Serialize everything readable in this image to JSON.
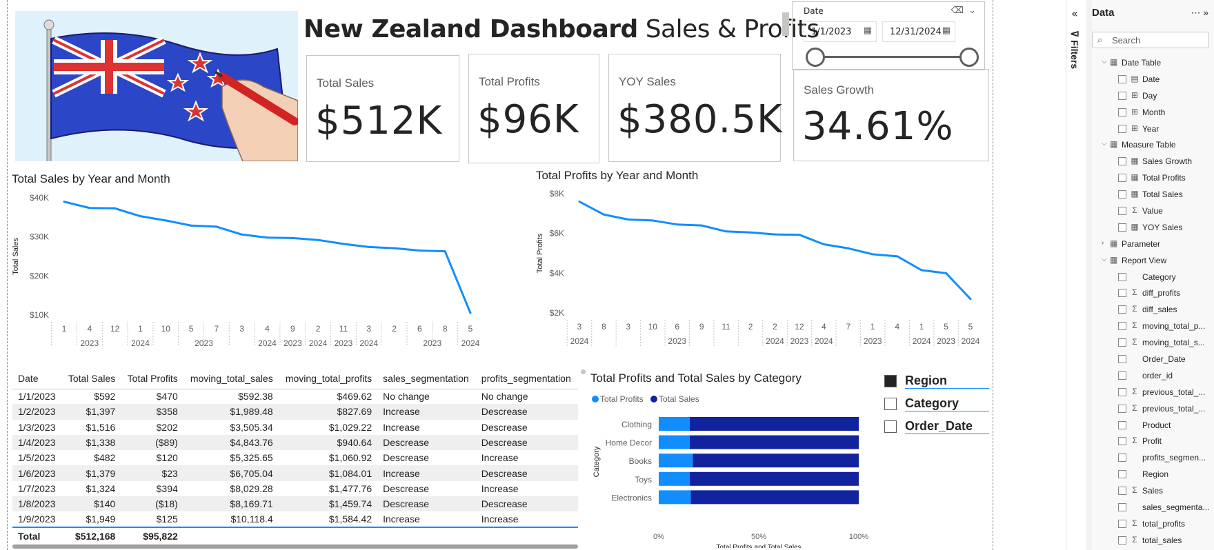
{
  "title": {
    "bold": "New Zealand Dashboard",
    "light": " Sales & Profits"
  },
  "kpis": [
    {
      "label": "Total Sales",
      "value": "$512K"
    },
    {
      "label": "Total Profits",
      "value": "$96K"
    },
    {
      "label": "YOY Sales",
      "value": "$380.5K"
    },
    {
      "label": "Sales Growth",
      "value": "34.61%"
    }
  ],
  "date_slicer": {
    "label": "Date",
    "start": "1/1/2023",
    "end": "12/31/2024",
    "range_selected": [
      0,
      1
    ]
  },
  "sales_chart": {
    "title": "Total Sales by Year and Month",
    "ylabel": "Total Sales",
    "yticks": [
      "$40K",
      "$30K",
      "$20K",
      "$10K"
    ],
    "month_ticks": [
      "1",
      "4",
      "12",
      "1",
      "10",
      "5",
      "7",
      "3",
      "4",
      "9",
      "2",
      "11",
      "3",
      "2",
      "6",
      "8",
      "5"
    ],
    "year_ticks": [
      {
        "label": "2023",
        "col": 1
      },
      {
        "label": "2024",
        "col": 3
      },
      {
        "label": "2023",
        "col": 5.5
      },
      {
        "label": "2024",
        "col": 8
      },
      {
        "label": "2023",
        "col": 9
      },
      {
        "label": "2024",
        "col": 10
      },
      {
        "label": "2023",
        "col": 11
      },
      {
        "label": "2024",
        "col": 12
      },
      {
        "label": "2023",
        "col": 14.5
      },
      {
        "label": "2024",
        "col": 16
      }
    ]
  },
  "profits_chart": {
    "title": "Total Profits by Year and Month",
    "ylabel": "Total Profits",
    "yticks": [
      "$8K",
      "$6K",
      "$4K",
      "$2K"
    ],
    "month_ticks": [
      "3",
      "8",
      "3",
      "10",
      "6",
      "9",
      "11",
      "2",
      "2",
      "12",
      "4",
      "7",
      "1",
      "4",
      "1",
      "5",
      "5"
    ],
    "year_ticks": [
      {
        "label": "2024",
        "col": 0
      },
      {
        "label": "2023",
        "col": 4
      },
      {
        "label": "2024",
        "col": 8
      },
      {
        "label": "2023",
        "col": 9
      },
      {
        "label": "2024",
        "col": 10
      },
      {
        "label": "2023",
        "col": 12
      },
      {
        "label": "2024",
        "col": 14
      },
      {
        "label": "2023",
        "col": 15
      },
      {
        "label": "2024",
        "col": 16
      }
    ]
  },
  "chart_data": [
    {
      "type": "line",
      "title": "Total Sales by Year and Month",
      "ylabel": "Total Sales",
      "ylim": [
        10000,
        40000
      ],
      "x": [
        "2023-1",
        "2023-4",
        "2023-12",
        "2024-1",
        "2024-10",
        "2023-5",
        "2023-7",
        "2023-3",
        "2024-4",
        "2023-9",
        "2024-2",
        "2023-11",
        "2024-3",
        "2023-2",
        "2023-6",
        "2023-8",
        "2024-5"
      ],
      "values": [
        39000,
        37400,
        37300,
        35300,
        34200,
        32900,
        32600,
        30600,
        29800,
        29700,
        29200,
        28200,
        27400,
        27100,
        26500,
        26300,
        10500
      ],
      "color": "#118dff"
    },
    {
      "type": "line",
      "title": "Total Profits by Year and Month",
      "ylabel": "Total Profits",
      "ylim": [
        2000,
        8000
      ],
      "x": [
        "2024-3",
        "2023-8",
        "2023-3",
        "2023-10",
        "2023-6",
        "2023-9",
        "2023-11",
        "2023-2",
        "2024-2",
        "2023-12",
        "2024-4",
        "2023-7",
        "2023-1",
        "2023-4",
        "2024-1",
        "2023-5",
        "2024-5"
      ],
      "values": [
        7600,
        6950,
        6700,
        6650,
        6450,
        6400,
        6100,
        6050,
        5950,
        5930,
        5450,
        5250,
        4950,
        4850,
        4150,
        4000,
        2700
      ],
      "color": "#118dff"
    },
    {
      "type": "bar",
      "orientation": "horizontal-stacked-100",
      "title": "Total Profits and Total Sales by Category",
      "xlabel": "Total Profits and Total Sales",
      "ylabel": "Category",
      "categories": [
        "Clothing",
        "Home Decor",
        "Books",
        "Toys",
        "Electronics"
      ],
      "series": [
        {
          "name": "Total Profits",
          "values": [
            15.5,
            15.5,
            17,
            15.5,
            16
          ],
          "color": "#118dff"
        },
        {
          "name": "Total Sales",
          "values": [
            84.5,
            84.5,
            83,
            84.5,
            84
          ],
          "color": "#12239e"
        }
      ],
      "xticks": [
        "0%",
        "50%",
        "100%"
      ],
      "xlim": [
        0,
        100
      ]
    }
  ],
  "table": {
    "columns": [
      "Date",
      "Total Sales",
      "Total Profits",
      "moving_total_sales",
      "moving_total_profits",
      "sales_segmentation",
      "profits_segmentation"
    ],
    "rows": [
      [
        "1/1/2023",
        "$592",
        "$470",
        "$592.38",
        "$469.62",
        "No change",
        "No change"
      ],
      [
        "1/2/2023",
        "$1,397",
        "$358",
        "$1,989.48",
        "$827.69",
        "Increase",
        "Descrease"
      ],
      [
        "1/3/2023",
        "$1,516",
        "$202",
        "$3,505.34",
        "$1,029.22",
        "Increase",
        "Descrease"
      ],
      [
        "1/4/2023",
        "$1,338",
        "($89)",
        "$4,843.76",
        "$940.64",
        "Descrease",
        "Descrease"
      ],
      [
        "1/5/2023",
        "$482",
        "$120",
        "$5,325.65",
        "$1,060.92",
        "Descrease",
        "Increase"
      ],
      [
        "1/6/2023",
        "$1,379",
        "$23",
        "$6,705.04",
        "$1,084.01",
        "Increase",
        "Descrease"
      ],
      [
        "1/7/2023",
        "$1,324",
        "$394",
        "$8,029.28",
        "$1,477.76",
        "Descrease",
        "Increase"
      ],
      [
        "1/8/2023",
        "$140",
        "($18)",
        "$8,169.71",
        "$1,459.74",
        "Descrease",
        "Descrease"
      ],
      [
        "1/9/2023",
        "$1,949",
        "$125",
        "$10,118.4",
        "$1,584.42",
        "Increase",
        "Increase"
      ]
    ],
    "total": [
      "Total",
      "$512,168",
      "$95,822",
      "",
      "",
      "",
      ""
    ]
  },
  "field_slicer": [
    {
      "label": "Region",
      "checked": true
    },
    {
      "label": "Category",
      "checked": false
    },
    {
      "label": "Order_Date",
      "checked": false
    }
  ],
  "filters_pane": {
    "label": "Filters"
  },
  "data_pane": {
    "title": "Data",
    "search_placeholder": "Search",
    "tree": [
      {
        "type": "table",
        "name": "Date Table",
        "expanded": true
      },
      {
        "type": "field",
        "icon": "calendar-icon",
        "name": "Date"
      },
      {
        "type": "field",
        "icon": "hierarchy-icon",
        "name": "Day"
      },
      {
        "type": "field",
        "icon": "hierarchy-icon",
        "name": "Month"
      },
      {
        "type": "field",
        "icon": "hierarchy-icon",
        "name": "Year"
      },
      {
        "type": "table",
        "name": "Measure Table",
        "expanded": true
      },
      {
        "type": "field",
        "icon": "measure-icon",
        "name": "Sales Growth"
      },
      {
        "type": "field",
        "icon": "measure-icon",
        "name": "Total Profits"
      },
      {
        "type": "field",
        "icon": "measure-icon",
        "name": "Total Sales"
      },
      {
        "type": "field",
        "icon": "sigma-icon",
        "name": "Value"
      },
      {
        "type": "field",
        "icon": "measure-icon",
        "name": "YOY Sales"
      },
      {
        "type": "table",
        "name": "Parameter",
        "expanded": false
      },
      {
        "type": "table",
        "name": "Report View",
        "expanded": true
      },
      {
        "type": "field",
        "icon": "",
        "name": "Category"
      },
      {
        "type": "field",
        "icon": "sigma-icon",
        "name": "diff_profits"
      },
      {
        "type": "field",
        "icon": "sigma-icon",
        "name": "diff_sales"
      },
      {
        "type": "field",
        "icon": "sigma-icon",
        "name": "moving_total_p..."
      },
      {
        "type": "field",
        "icon": "sigma-icon",
        "name": "moving_total_s..."
      },
      {
        "type": "field",
        "icon": "",
        "name": "Order_Date"
      },
      {
        "type": "field",
        "icon": "",
        "name": "order_id"
      },
      {
        "type": "field",
        "icon": "sigma-icon",
        "name": "previous_total_..."
      },
      {
        "type": "field",
        "icon": "sigma-icon",
        "name": "previous_total_..."
      },
      {
        "type": "field",
        "icon": "",
        "name": "Product"
      },
      {
        "type": "field",
        "icon": "sigma-icon",
        "name": "Profit"
      },
      {
        "type": "field",
        "icon": "",
        "name": "profits_segmen..."
      },
      {
        "type": "field",
        "icon": "",
        "name": "Region"
      },
      {
        "type": "field",
        "icon": "sigma-icon",
        "name": "Sales"
      },
      {
        "type": "field",
        "icon": "",
        "name": "sales_segmenta..."
      },
      {
        "type": "field",
        "icon": "sigma-icon",
        "name": "total_profits"
      },
      {
        "type": "field",
        "icon": "sigma-icon",
        "name": "total_sales"
      }
    ]
  },
  "colors": {
    "accent": "#118dff",
    "dark_series": "#12239e",
    "border": "#c8c6c4"
  }
}
